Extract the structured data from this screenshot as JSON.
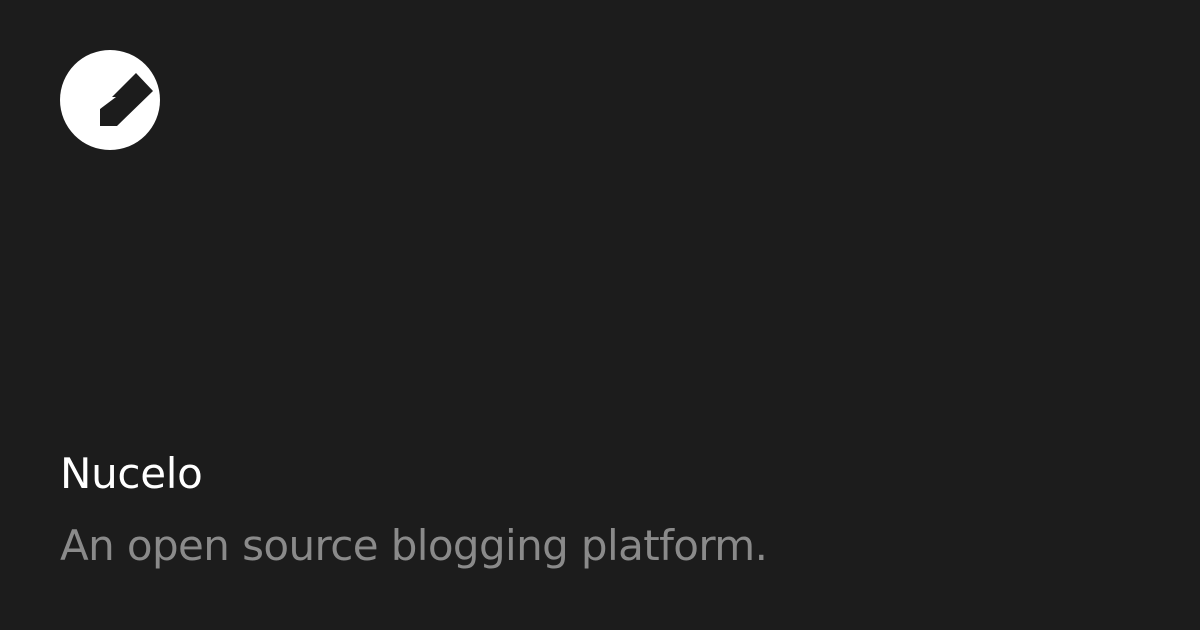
{
  "brand": {
    "logo_icon": "nucelo-logo-icon",
    "name": "Nucelo",
    "tagline": "An open source blogging platform."
  },
  "colors": {
    "background": "#1c1c1c",
    "title": "#ffffff",
    "tagline": "#8a8a8a",
    "logo": "#ffffff"
  }
}
